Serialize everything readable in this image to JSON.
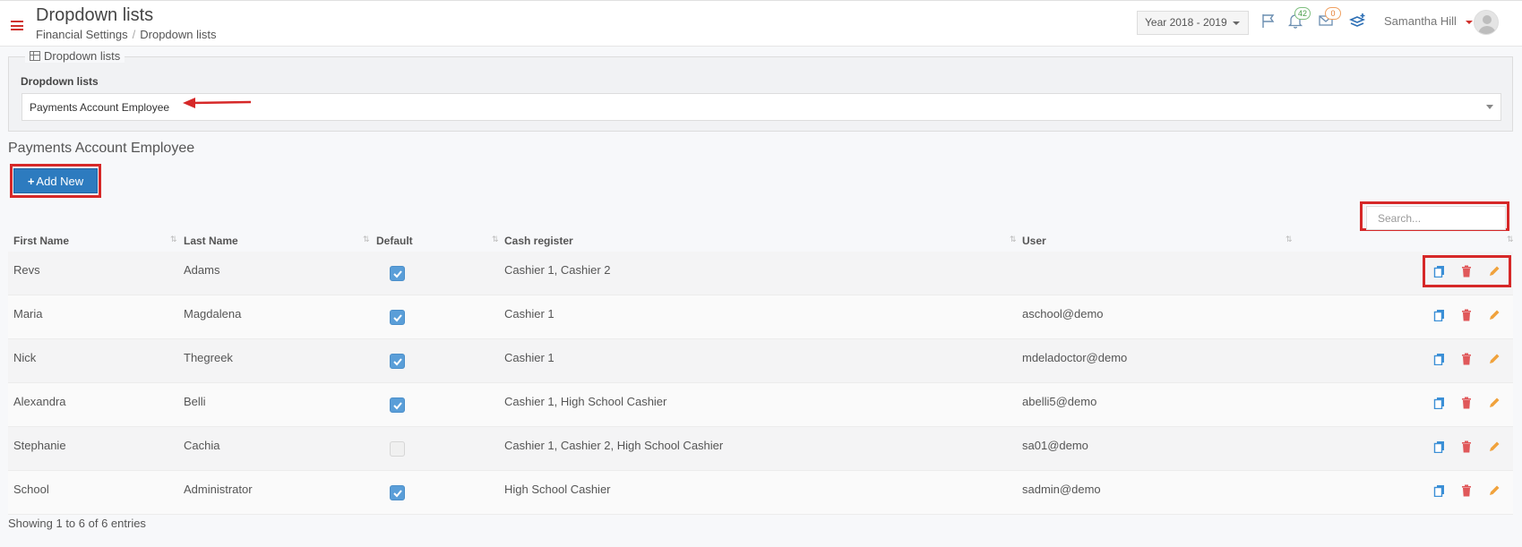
{
  "header": {
    "title": "Dropdown lists",
    "breadcrumb": [
      "Financial Settings",
      "Dropdown lists"
    ],
    "year_select": "Year 2018 - 2019",
    "notifications_count": "42",
    "messages_count": "0",
    "user_name": "Samantha Hill"
  },
  "panel": {
    "legend": "Dropdown lists",
    "field_label": "Dropdown lists",
    "selected_value": "Payments Account Employee"
  },
  "section": {
    "title": "Payments Account Employee",
    "add_button": "Add New",
    "search_placeholder": "Search..."
  },
  "table": {
    "columns": [
      "First Name",
      "Last Name",
      "Default",
      "Cash register",
      "User"
    ],
    "rows": [
      {
        "first": "Revs",
        "last": "Adams",
        "default": true,
        "cash": "Cashier 1, Cashier 2",
        "user": ""
      },
      {
        "first": "Maria",
        "last": "Magdalena",
        "default": true,
        "cash": "Cashier 1",
        "user": "aschool@demo"
      },
      {
        "first": "Nick",
        "last": "Thegreek",
        "default": true,
        "cash": "Cashier 1",
        "user": "mdeladoctor@demo"
      },
      {
        "first": "Alexandra",
        "last": "Belli",
        "default": true,
        "cash": "Cashier 1, High School Cashier",
        "user": "abelli5@demo"
      },
      {
        "first": "Stephanie",
        "last": "Cachia",
        "default": false,
        "cash": "Cashier 1, Cashier 2, High School Cashier",
        "user": "sa01@demo"
      },
      {
        "first": "School",
        "last": "Administrator",
        "default": true,
        "cash": "High School Cashier",
        "user": "sadmin@demo"
      }
    ]
  },
  "footer": {
    "info": "Showing 1 to 6 of 6 entries"
  },
  "colors": {
    "accent_blue": "#2d7bbf",
    "highlight_red": "#d62828",
    "delete_red": "#e0585a",
    "edit_orange": "#f0a23c",
    "copy_blue": "#3b8fd6"
  },
  "icons": [
    "menu-icon",
    "flag-icon",
    "bell-icon",
    "envelope-icon",
    "layers-icon",
    "table-icon",
    "copy-icon",
    "trash-icon",
    "pencil-icon"
  ]
}
